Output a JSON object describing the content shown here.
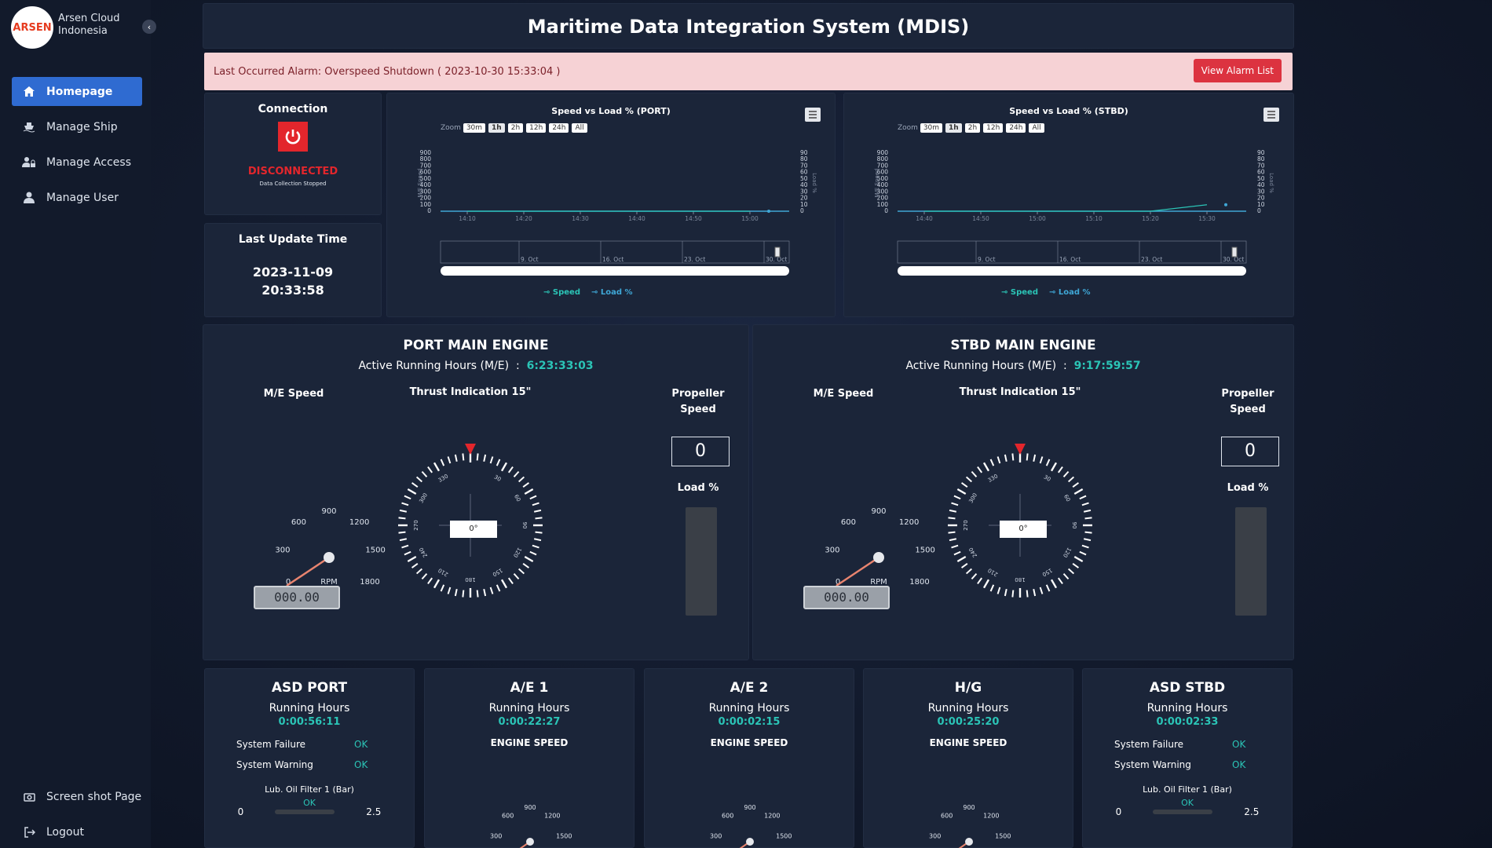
{
  "sidebar": {
    "brand": "Arsen Cloud Indonesia",
    "logo_text": "ARSEN",
    "items": [
      {
        "label": "Homepage",
        "icon": "home-icon"
      },
      {
        "label": "Manage Ship",
        "icon": "ship-icon"
      },
      {
        "label": "Manage Access",
        "icon": "user-lock-icon"
      },
      {
        "label": "Manage User",
        "icon": "user-icon"
      }
    ],
    "bottom": [
      {
        "label": "Screen shot Page",
        "icon": "camera-icon"
      },
      {
        "label": "Logout",
        "icon": "logout-icon"
      }
    ]
  },
  "header": {
    "title": "Maritime Data Integration System (MDIS)"
  },
  "alarm": {
    "text": "Last Occurred Alarm: Overspeed Shutdown ( 2023-10-30 15:33:04 )",
    "button": "View Alarm List"
  },
  "connection": {
    "title": "Connection",
    "status": "DISCONNECTED",
    "sub": "Data Collection Stopped"
  },
  "last_update": {
    "title": "Last Update Time",
    "date": "2023-11-09",
    "time": "20:33:58"
  },
  "charts": {
    "zoom_label": "Zoom",
    "zoom_options": [
      "30m",
      "1h",
      "2h",
      "12h",
      "24h",
      "All"
    ],
    "selected_zoom": "1h",
    "port": {
      "title": "Speed vs Load % (PORT)",
      "x_ticks": [
        "14:10",
        "14:20",
        "14:30",
        "14:40",
        "14:50",
        "15:00"
      ],
      "nav_ticks": [
        "9. Oct",
        "16. Oct",
        "23. Oct",
        "30. Oct"
      ]
    },
    "stbd": {
      "title": "Speed vs Load % (STBD)",
      "x_ticks": [
        "14:40",
        "14:50",
        "15:00",
        "15:10",
        "15:20",
        "15:30"
      ],
      "nav_ticks": [
        "9. Oct",
        "16. Oct",
        "23. Oct",
        "30. Oct"
      ]
    },
    "left_axis": [
      "900",
      "800",
      "700",
      "600",
      "500",
      "400",
      "300",
      "200",
      "100",
      "0"
    ],
    "right_axis": [
      "90",
      "80",
      "70",
      "60",
      "50",
      "40",
      "30",
      "20",
      "10",
      "0"
    ],
    "left_label": "M/E Speed",
    "right_label": "Load %",
    "legend": [
      "Speed",
      "Load %"
    ]
  },
  "chart_data": [
    {
      "type": "line",
      "title": "Speed vs Load % (PORT)",
      "series": [
        {
          "name": "Speed",
          "values": [
            0,
            0,
            0,
            0,
            0,
            0
          ]
        },
        {
          "name": "Load %",
          "values": [
            0,
            0,
            0,
            0,
            0,
            0
          ]
        }
      ],
      "x": [
        "14:10",
        "14:20",
        "14:30",
        "14:40",
        "14:50",
        "15:00"
      ],
      "ylim": [
        0,
        900
      ]
    },
    {
      "type": "line",
      "title": "Speed vs Load % (STBD)",
      "series": [
        {
          "name": "Speed",
          "values": [
            0,
            0,
            0,
            0,
            0,
            0
          ]
        },
        {
          "name": "Load %",
          "values": [
            0,
            0,
            0,
            0,
            0,
            10
          ]
        }
      ],
      "x": [
        "14:40",
        "14:50",
        "15:00",
        "15:10",
        "15:20",
        "15:30"
      ],
      "ylim": [
        0,
        900
      ]
    }
  ],
  "engines": {
    "port": {
      "title": "PORT MAIN ENGINE",
      "hours_label": "Active Running Hours (M/E)",
      "hours": "6:23:33:03",
      "speed_label": "M/E Speed",
      "thrust_label": "Thrust Indication 15\"",
      "prop_label": "Propeller Speed",
      "prop_value": "0",
      "load_label": "Load %",
      "rpm": "000.00",
      "angle": "0°"
    },
    "stbd": {
      "title": "STBD MAIN ENGINE",
      "hours_label": "Active Running Hours (M/E)",
      "hours": "9:17:59:57",
      "speed_label": "M/E Speed",
      "thrust_label": "Thrust Indication 15\"",
      "prop_label": "Propeller Speed",
      "prop_value": "0",
      "load_label": "Load %",
      "rpm": "000.00",
      "angle": "0°"
    }
  },
  "gauge": {
    "ticks": [
      "0",
      "300",
      "600",
      "900",
      "1200",
      "1500",
      "1800"
    ],
    "unit": "RPM",
    "compass": [
      "330",
      "30",
      "60",
      "90",
      "120",
      "150",
      "180",
      "210",
      "240",
      "270",
      "300"
    ]
  },
  "bottom": [
    {
      "title": "ASD PORT",
      "rh_label": "Running Hours",
      "rh": "0:00:56:11",
      "rows": [
        {
          "label": "System Failure",
          "value": "OK"
        },
        {
          "label": "System Warning",
          "value": "OK"
        }
      ],
      "filter": "Lub. Oil Filter 1 (Bar)",
      "filter_status": "OK",
      "min": "0",
      "max": "2.5"
    },
    {
      "title": "A/E 1",
      "rh_label": "Running Hours",
      "rh": "0:00:22:27",
      "sub": "ENGINE SPEED"
    },
    {
      "title": "A/E 2",
      "rh_label": "Running Hours",
      "rh": "0:00:02:15",
      "sub": "ENGINE SPEED"
    },
    {
      "title": "H/G",
      "rh_label": "Running Hours",
      "rh": "0:00:25:20",
      "sub": "ENGINE SPEED"
    },
    {
      "title": "ASD STBD",
      "rh_label": "Running Hours",
      "rh": "0:00:02:33",
      "rows": [
        {
          "label": "System Failure",
          "value": "OK"
        },
        {
          "label": "System Warning",
          "value": "OK"
        }
      ],
      "filter": "Lub. Oil Filter 1 (Bar)",
      "filter_status": "OK",
      "min": "0",
      "max": "2.5"
    }
  ],
  "colors": {
    "accent": "#2bc4b6",
    "danger": "#dc3340",
    "nav_active": "#2f6bd1",
    "panel": "#1b2539"
  }
}
